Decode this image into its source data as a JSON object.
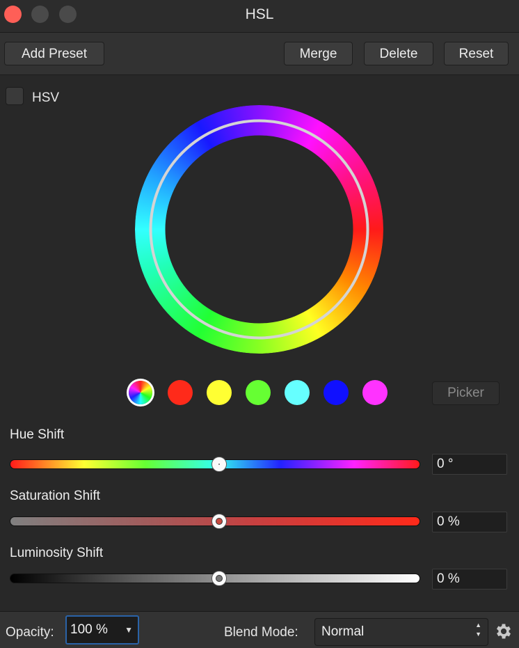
{
  "window": {
    "title": "HSL"
  },
  "toolbar": {
    "add_preset": "Add Preset",
    "merge": "Merge",
    "delete": "Delete",
    "reset": "Reset"
  },
  "hsv": {
    "label": "HSV",
    "checked": false
  },
  "swatches": [
    {
      "name": "all-colors",
      "color": "wheel"
    },
    {
      "name": "reds",
      "color": "#ff2a1a"
    },
    {
      "name": "yellows",
      "color": "#ffff33"
    },
    {
      "name": "greens",
      "color": "#66ff33"
    },
    {
      "name": "cyans",
      "color": "#66ffff"
    },
    {
      "name": "blues",
      "color": "#1010ff"
    },
    {
      "name": "magentas",
      "color": "#ff33ff"
    }
  ],
  "picker": {
    "label": "Picker"
  },
  "sliders": {
    "hue": {
      "label": "Hue Shift",
      "value": "0 °",
      "position": 0.5
    },
    "saturation": {
      "label": "Saturation Shift",
      "value": "0 %",
      "position": 0.5
    },
    "luminosity": {
      "label": "Luminosity Shift",
      "value": "0 %",
      "position": 0.5
    }
  },
  "footer": {
    "opacity_label": "Opacity:",
    "opacity_value": "100 %",
    "blend_label": "Blend Mode:",
    "blend_value": "Normal"
  },
  "colors": {
    "accent": "#2a63a8",
    "close": "#fe5f57"
  }
}
